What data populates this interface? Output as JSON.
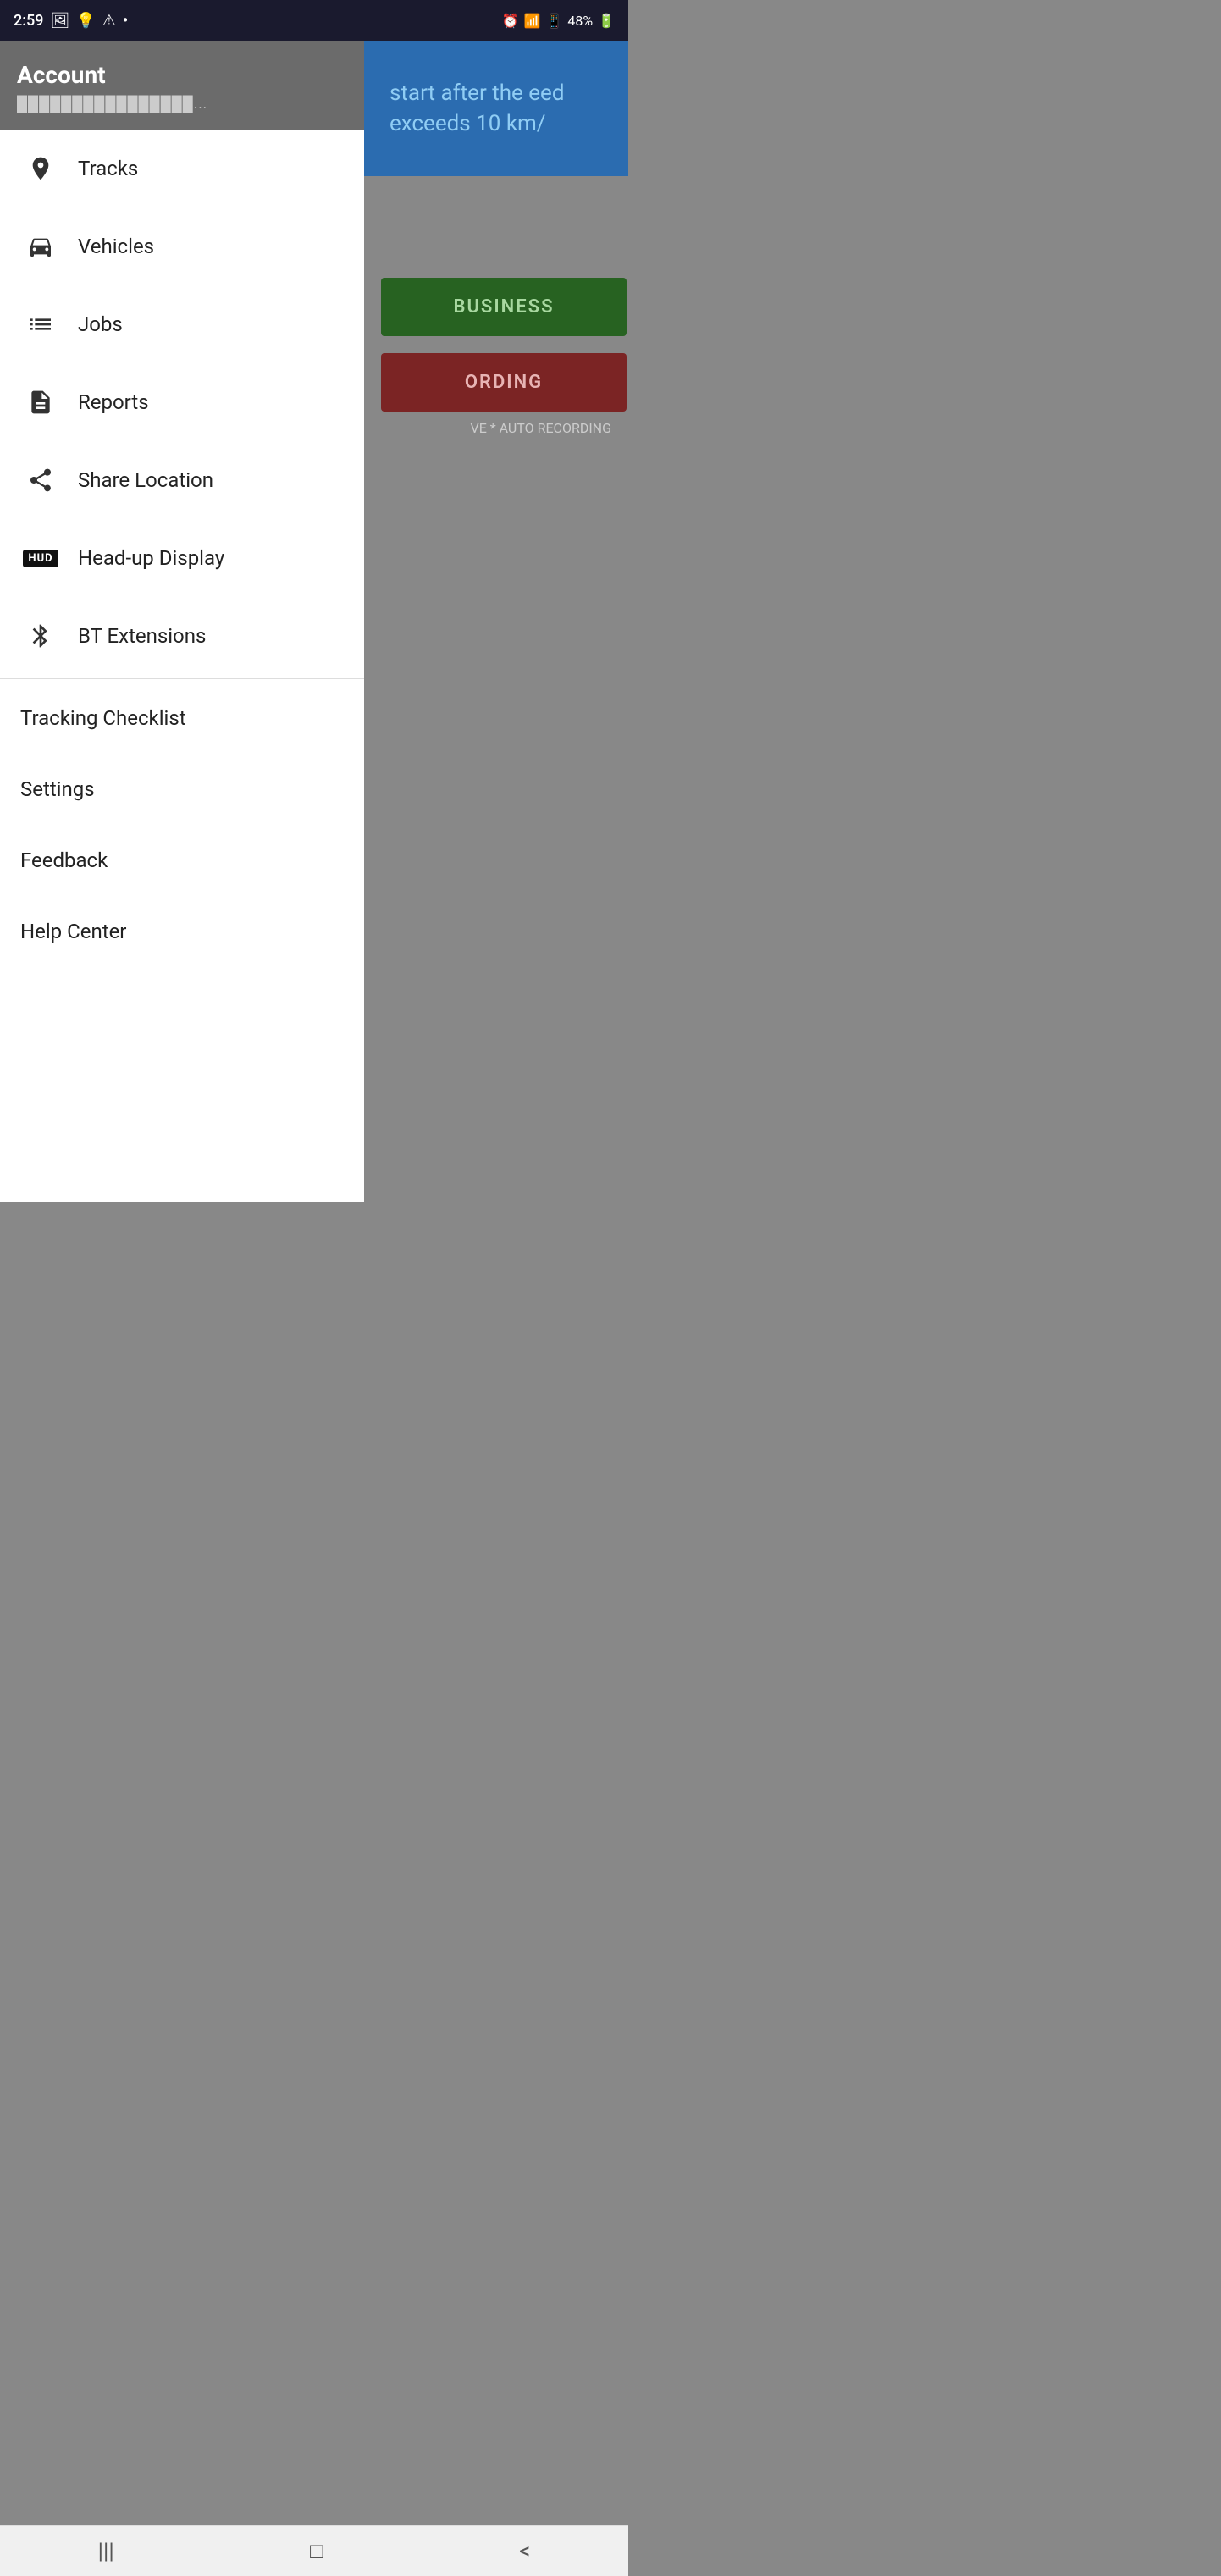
{
  "statusBar": {
    "time": "2:59",
    "battery": "48%"
  },
  "account": {
    "title": "Account",
    "email": "████████████████..."
  },
  "mainContent": {
    "blueText": "start after the\need exceeds 10 km/",
    "businessLabel": "BUSINESS",
    "recordingLabel": "ORDING",
    "autoRecordingText": "VE * AUTO RECORDING"
  },
  "menuItems": [
    {
      "id": "tracks",
      "label": "Tracks",
      "icon": "location-pin"
    },
    {
      "id": "vehicles",
      "label": "Vehicles",
      "icon": "car"
    },
    {
      "id": "jobs",
      "label": "Jobs",
      "icon": "list"
    },
    {
      "id": "reports",
      "label": "Reports",
      "icon": "document"
    },
    {
      "id": "share-location",
      "label": "Share Location",
      "icon": "share"
    },
    {
      "id": "head-up-display",
      "label": "Head-up Display",
      "icon": "hud"
    },
    {
      "id": "bt-extensions",
      "label": "BT Extensions",
      "icon": "bluetooth"
    }
  ],
  "bottomMenuItems": [
    {
      "id": "tracking-checklist",
      "label": "Tracking Checklist"
    },
    {
      "id": "settings",
      "label": "Settings"
    },
    {
      "id": "feedback",
      "label": "Feedback"
    },
    {
      "id": "help-center",
      "label": "Help Center"
    }
  ],
  "bottomNav": {
    "menu": "|||",
    "home": "□",
    "back": "<"
  }
}
